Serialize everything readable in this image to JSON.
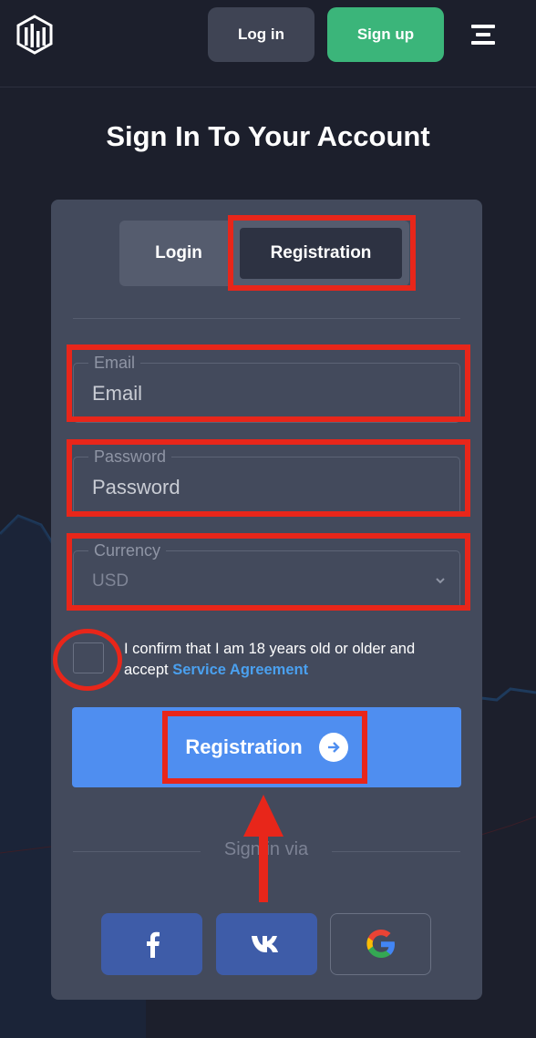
{
  "header": {
    "logo_icon": "bars-chart-logo-icon",
    "login_label": "Log in",
    "signup_label": "Sign up",
    "menu_icon": "hamburger-menu-icon"
  },
  "page_title": "Sign In To Your Account",
  "tabs": [
    {
      "label": "Login",
      "active": false
    },
    {
      "label": "Registration",
      "active": true
    }
  ],
  "form": {
    "email": {
      "legend": "Email",
      "placeholder": "Email",
      "value": ""
    },
    "password": {
      "legend": "Password",
      "placeholder": "Password",
      "value": ""
    },
    "currency": {
      "legend": "Currency",
      "selected": "USD"
    },
    "agreement": {
      "text": "I confirm that I am 18 years old or older and accept",
      "link": "Service Agreement",
      "checked": false
    },
    "submit_label": "Registration"
  },
  "sign_in_via": "Sign in via",
  "social": [
    {
      "name": "facebook",
      "icon": "facebook-icon"
    },
    {
      "name": "vk",
      "icon": "vk-icon"
    },
    {
      "name": "google",
      "icon": "google-icon"
    }
  ],
  "colors": {
    "background": "#1c1f2c",
    "card": "#434a5c",
    "signup_green": "#3bb57a",
    "primary_blue": "#4f8ef0",
    "link_blue": "#4aa0ef",
    "social_blue": "#3e5ca8",
    "annotation_red": "#e8261a"
  }
}
